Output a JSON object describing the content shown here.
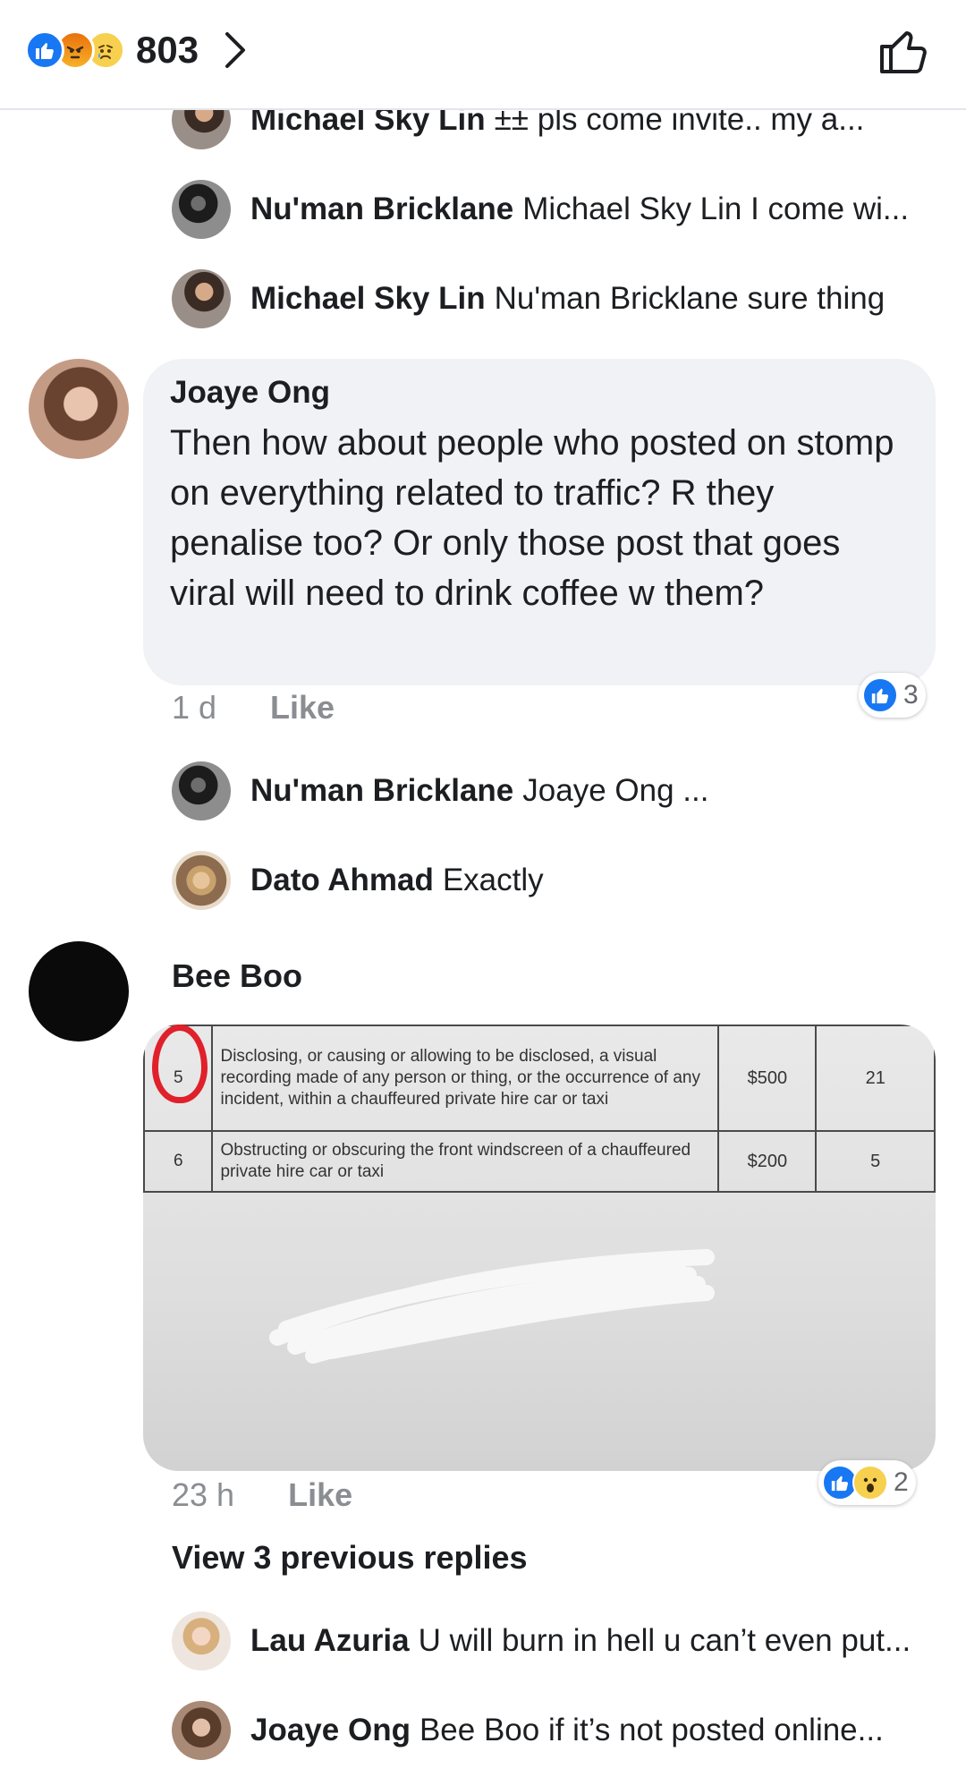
{
  "header": {
    "reaction_count": "803",
    "reaction_icons": [
      "like-reaction-icon",
      "angry-reaction-icon",
      "sad-reaction-icon"
    ]
  },
  "thread": {
    "replies_top": [
      {
        "name": "Michael Sky Lin",
        "text": "±± pls come invite.. my a..."
      },
      {
        "name": "Nu'man Bricklane",
        "text": "Michael Sky Lin I come wi..."
      },
      {
        "name": "Michael Sky Lin",
        "text": "Nu'man Bricklane sure thing"
      }
    ],
    "comment_1": {
      "author": "Joaye Ong",
      "text": "Then how about people who posted on stomp on everything related to traffic? R they penalise too? Or only those post that goes viral will need to drink coffee w them?",
      "time": "1 d",
      "like_label": "Like",
      "reaction_count": "3"
    },
    "replies_mid": [
      {
        "name": "Nu'man Bricklane",
        "text": "Joaye Ong ..."
      },
      {
        "name": "Dato Ahmad",
        "text": "Exactly"
      }
    ],
    "comment_2": {
      "author": "Bee Boo",
      "time": "23 h",
      "like_label": "Like",
      "reaction_count": "2",
      "photo_table": [
        {
          "no": "5",
          "desc": "Disclosing, or causing or allowing to be disclosed, a visual recording made of any person or thing, or the occurrence of any incident, within a chauffeured private hire car or taxi",
          "amount": "$500",
          "points": "21"
        },
        {
          "no": "6",
          "desc": "Obstructing or obscuring the front windscreen of a chauffeured private hire car or taxi",
          "amount": "$200",
          "points": "5"
        }
      ]
    },
    "view_previous": "View 3 previous replies",
    "replies_bottom": [
      {
        "name": "Lau Azuria",
        "text": "U will burn in hell u can’t even put..."
      },
      {
        "name": "Joaye Ong",
        "text": "Bee Boo if it’s not posted online..."
      }
    ]
  },
  "colors": {
    "facebook_blue": "#1877f2",
    "bubble_bg": "#f0f2f5",
    "meta_gray": "#8a8d91"
  }
}
